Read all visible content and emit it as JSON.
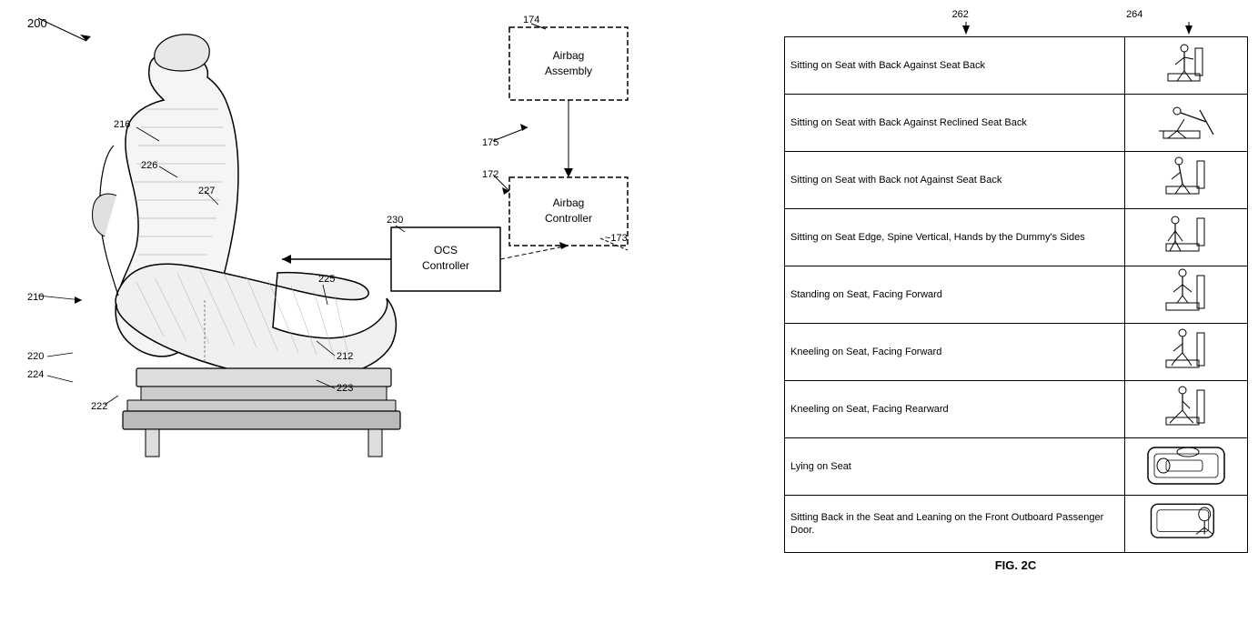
{
  "left": {
    "main_ref": "200",
    "arrow_ref": "200",
    "refs": [
      {
        "id": "210",
        "label": "210"
      },
      {
        "id": "212",
        "label": "212"
      },
      {
        "id": "216",
        "label": "216"
      },
      {
        "id": "220",
        "label": "220"
      },
      {
        "id": "222",
        "label": "222"
      },
      {
        "id": "223",
        "label": "223"
      },
      {
        "id": "224",
        "label": "224"
      },
      {
        "id": "225",
        "label": "225"
      },
      {
        "id": "226",
        "label": "226"
      },
      {
        "id": "227",
        "label": "227"
      },
      {
        "id": "230",
        "label": "230"
      },
      {
        "id": "172",
        "label": "172"
      },
      {
        "id": "173",
        "label": "173"
      },
      {
        "id": "174",
        "label": "174"
      },
      {
        "id": "175",
        "label": "175"
      }
    ],
    "ocs_label": "OCS\nController",
    "airbag_assembly_label": "Airbag\nAssembly",
    "airbag_controller_label": "Airbag\nController"
  },
  "right": {
    "col_refs": [
      "262",
      "264"
    ],
    "rows": [
      {
        "description": "Sitting on Seat with Back Against Seat Back",
        "has_icon": true
      },
      {
        "description": "Sitting on Seat with Back Against Reclined Seat Back",
        "has_icon": true
      },
      {
        "description": "Sitting on Seat with Back not Against Seat Back",
        "has_icon": true
      },
      {
        "description": "Sitting on Seat Edge, Spine Vertical, Hands by the Dummy's Sides",
        "has_icon": true
      },
      {
        "description": "Standing on Seat, Facing Forward",
        "has_icon": true
      },
      {
        "description": "Kneeling on Seat, Facing Forward",
        "has_icon": true
      },
      {
        "description": "Kneeling on Seat, Facing Rearward",
        "has_icon": true
      },
      {
        "description": "Lying on Seat",
        "has_icon": true
      },
      {
        "description": "Sitting Back in the Seat and Leaning on the Front Outboard Passenger Door.",
        "has_icon": true
      }
    ],
    "fig_caption": "FIG. 2C"
  }
}
